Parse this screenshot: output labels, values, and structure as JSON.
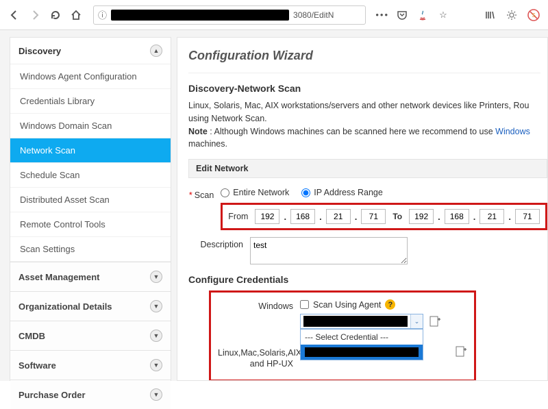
{
  "url_tail": "3080/EditN",
  "sidebar": {
    "header": "Discovery",
    "items": [
      "Windows Agent Configuration",
      "Credentials Library",
      "Windows Domain Scan",
      "Network Scan",
      "Schedule Scan",
      "Distributed Asset Scan",
      "Remote Control Tools",
      "Scan Settings"
    ],
    "active_index": 3,
    "sections": [
      "Asset Management",
      "Organizational Details",
      "CMDB",
      "Software",
      "Purchase Order"
    ]
  },
  "main": {
    "title": "Configuration Wizard",
    "subtitle": "Discovery-Network Scan",
    "desc1": "Linux, Solaris, Mac, AIX workstations/servers and other network devices like Printers, Rou",
    "desc2": "using Network Scan.",
    "note_label": "Note",
    "note_text": " : Although Windows machines can be scanned here we recommend to use ",
    "note_link": "Windows",
    "note_tail": " machines.",
    "edit_network": "Edit Network",
    "scan_label": "Scan",
    "opt_entire": "Entire Network",
    "opt_range": "IP Address Range",
    "from_label": "From",
    "to_label": "To",
    "ip_from": [
      "192",
      "168",
      "21",
      "71"
    ],
    "ip_to": [
      "192",
      "168",
      "21",
      "71"
    ],
    "desc_label": "Description",
    "desc_value": "test",
    "configure_cred": "Configure Credentials",
    "windows_label": "Windows",
    "scan_agent": "Scan Using Agent",
    "select_cred": "--- Select Credential ---",
    "linux_label": "Linux,Mac,Solaris,AIX and HP-UX"
  }
}
